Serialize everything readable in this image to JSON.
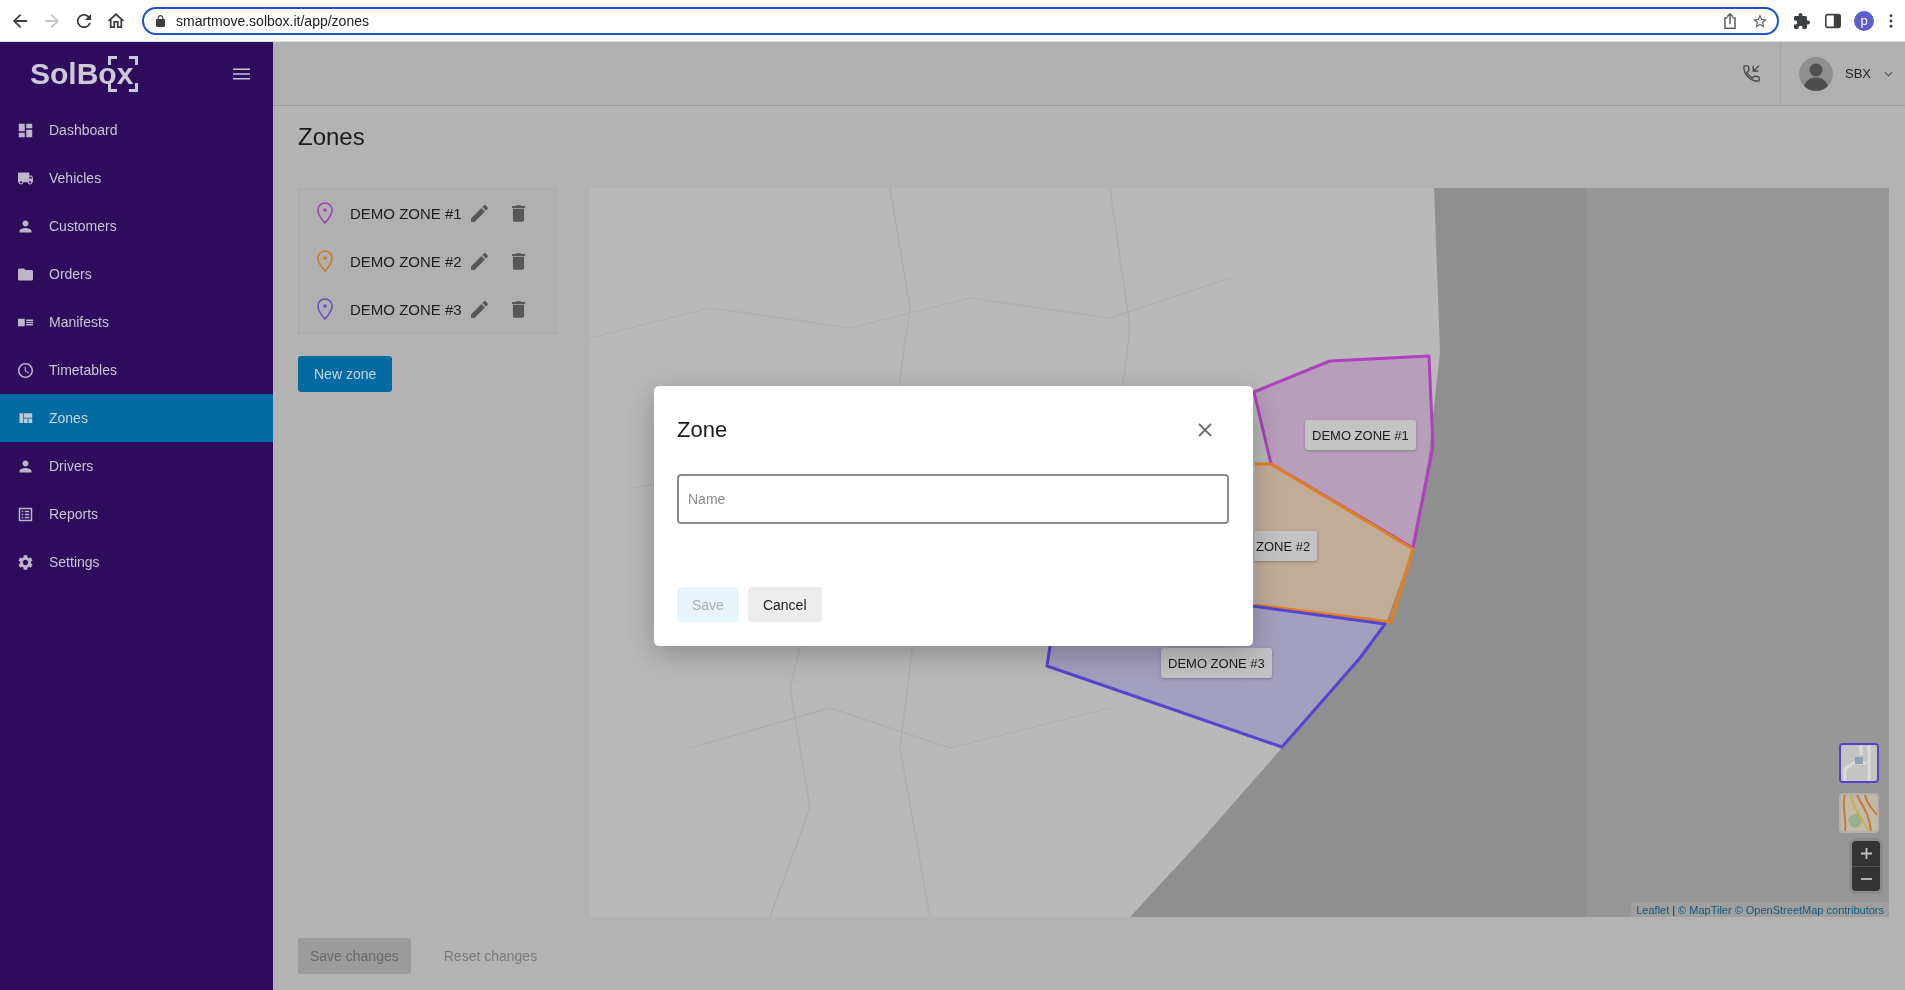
{
  "browser": {
    "nav": [
      {
        "kind": "back",
        "disabled": false
      },
      {
        "kind": "forward",
        "disabled": true
      },
      {
        "kind": "reload",
        "disabled": false
      },
      {
        "kind": "home",
        "disabled": false
      }
    ],
    "url": "smartmove.solbox.it/app/zones",
    "profile_initial": "p"
  },
  "sidebar": {
    "logo": "SolBox",
    "items": [
      {
        "label": "Dashboard",
        "kind": "dashboard",
        "selected": false
      },
      {
        "label": "Vehicles",
        "kind": "truck",
        "selected": false
      },
      {
        "label": "Customers",
        "kind": "person",
        "selected": false
      },
      {
        "label": "Orders",
        "kind": "folder",
        "selected": false
      },
      {
        "label": "Manifests",
        "kind": "manifest",
        "selected": false
      },
      {
        "label": "Timetables",
        "kind": "clock",
        "selected": false
      },
      {
        "label": "Zones",
        "kind": "zones",
        "selected": true
      },
      {
        "label": "Drivers",
        "kind": "person",
        "selected": false
      },
      {
        "label": "Reports",
        "kind": "reports",
        "selected": false
      },
      {
        "label": "Settings",
        "kind": "settings",
        "selected": false
      }
    ]
  },
  "header": {
    "user": "SBX"
  },
  "page": {
    "title": "Zones",
    "zones": [
      {
        "name": "DEMO ZONE #1",
        "color": "#a23fb4"
      },
      {
        "name": "DEMO ZONE #2",
        "color": "#cc7a26"
      },
      {
        "name": "DEMO ZONE #3",
        "color": "#6b4cc8"
      }
    ],
    "new_zone_button": "New zone",
    "map": {
      "zone_shapes": [
        {
          "label": "DEMO ZONE #1",
          "color": "#b040c0"
        },
        {
          "label": "ZONE #2",
          "color": "#e08020"
        },
        {
          "label": "DEMO ZONE #3",
          "color": "#5545d0"
        }
      ],
      "layers": [
        {
          "kind": "streets",
          "selected": true
        },
        {
          "kind": "terrain",
          "selected": false
        }
      ],
      "attribution": {
        "links": [
          "Leaflet",
          "© MapTiler",
          "© OpenStreetMap contributors"
        ],
        "separator": "|"
      }
    },
    "actions": [
      {
        "label": "Save changes",
        "kind": "contained",
        "disabled": true
      },
      {
        "label": "Reset changes",
        "kind": "text",
        "disabled": true
      }
    ]
  },
  "dialog": {
    "title": "Zone",
    "name_field": {
      "placeholder": "Name"
    },
    "buttons": [
      {
        "label": "Save",
        "kind": "primary",
        "disabled": true
      },
      {
        "label": "Cancel",
        "kind": "secondary",
        "disabled": false
      }
    ]
  }
}
